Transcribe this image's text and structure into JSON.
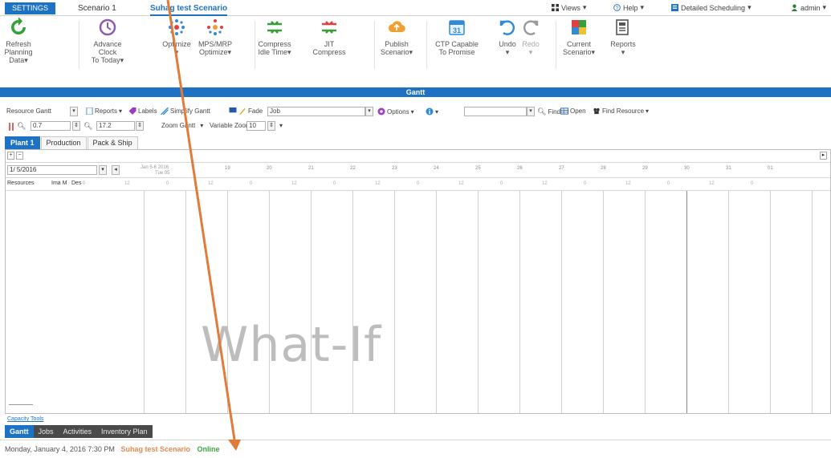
{
  "topbar": {
    "settings_label": "SETTINGS",
    "scenario_tabs": [
      "Scenario 1",
      "Suhag test Scenario"
    ],
    "views_label": "Views",
    "help_label": "Help",
    "detailed_label": "Detailed Scheduling",
    "user_label": "admin"
  },
  "ribbon": {
    "buttons": [
      {
        "line1": "Refresh",
        "line2": "Planning Data",
        "icon": "refresh-icon"
      },
      {
        "line1": "Advance Clock",
        "line2": "To Today",
        "icon": "clock-icon"
      },
      {
        "line1": "Optimize",
        "line2": "",
        "icon": "optimize-icon"
      },
      {
        "line1": "MPS/MRP",
        "line2": "Optimize",
        "icon": "mps-icon"
      },
      {
        "line1": "Compress",
        "line2": "Idle Time",
        "icon": "compress-icon"
      },
      {
        "line1": "JIT Compress",
        "line2": "",
        "icon": "jit-compress-icon"
      },
      {
        "line1": "Publish",
        "line2": "Scenario",
        "icon": "publish-icon"
      },
      {
        "line1": "CTP Capable",
        "line2": "To Promise",
        "icon": "calendar-icon"
      },
      {
        "line1": "Undo",
        "line2": "",
        "icon": "undo-icon"
      },
      {
        "line1": "Redo",
        "line2": "",
        "icon": "redo-icon"
      },
      {
        "line1": "Current",
        "line2": "Scenario",
        "icon": "current-scenario-icon"
      },
      {
        "line1": "Reports",
        "line2": "",
        "icon": "reports-icon"
      }
    ],
    "calendar_day": "31"
  },
  "gantt_header": "Gantt",
  "toolbar1": {
    "resource_gantt": "Resource Gantt",
    "reports": "Reports",
    "labels": "Labels",
    "simplify": "Simplify Gantt",
    "fade": "Fade",
    "fade_value": "Job",
    "options": "Options",
    "find": "Find",
    "open": "Open",
    "find_resource": "Find Resource"
  },
  "toolbar2": {
    "zoom1": "0.7",
    "zoom2": "17.2",
    "zoom_gantt": "Zoom Gantt",
    "variable_zoom": "Variable Zoom",
    "variable_value": "10"
  },
  "plant_tabs": [
    "Plant 1",
    "Production",
    "Pack & Ship"
  ],
  "gantt": {
    "date_value": "1/ 5/2016",
    "date_label": "Jan 5-6 2016",
    "date_sub": "Tue 05",
    "day_numbers": [
      "19",
      "20",
      "21",
      "22",
      "23",
      "24",
      "25",
      "26",
      "27",
      "28",
      "29",
      "30",
      "31",
      "01"
    ],
    "col_resources": "Resources",
    "col_ima": "Ima M",
    "col_des": "Des",
    "hour_marks": [
      "0",
      "12",
      "0",
      "12",
      "0",
      "12",
      "0",
      "12",
      "0",
      "12",
      "0",
      "12",
      "0",
      "12",
      "0",
      "12",
      "0"
    ],
    "watermark": "What-If"
  },
  "capacity_link": "Capacity Tools",
  "bottom_tabs": [
    "Gantt",
    "Jobs",
    "Activities",
    "Inventory Plan"
  ],
  "status": {
    "datetime": "Monday, January 4, 2016  7:30 PM",
    "scenario": "Suhag test Scenario",
    "online": "Online"
  },
  "colors": {
    "accent": "#1e72c3",
    "arrow": "#e07b39",
    "online": "#3aa83a"
  }
}
